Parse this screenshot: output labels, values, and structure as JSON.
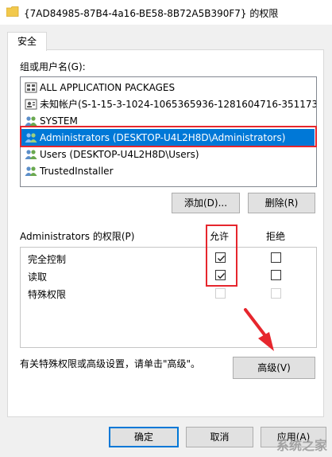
{
  "window": {
    "title": "{7AD84985-87B4-4a16-BE58-8B72A5B390F7} 的权限"
  },
  "tabs": [
    {
      "label": "安全"
    }
  ],
  "groups": {
    "label": "组或用户名(G):",
    "items": [
      {
        "label": "ALL APPLICATION PACKAGES",
        "icon": "app-packages-icon"
      },
      {
        "label": "未知帐户(S-1-15-3-1024-1065365936-1281604716-351173…",
        "icon": "unknown-account-icon"
      },
      {
        "label": "SYSTEM",
        "icon": "users-icon"
      },
      {
        "label": "Administrators (DESKTOP-U4L2H8D\\Administrators)",
        "icon": "users-icon",
        "selected": true
      },
      {
        "label": "Users (DESKTOP-U4L2H8D\\Users)",
        "icon": "users-icon"
      },
      {
        "label": "TrustedInstaller",
        "icon": "users-icon"
      }
    ]
  },
  "buttons": {
    "add": "添加(D)...",
    "remove": "删除(R)",
    "advanced": "高级(V)",
    "ok": "确定",
    "cancel": "取消",
    "apply": "应用(A)"
  },
  "permissions": {
    "header": "Administrators 的权限(P)",
    "allow_header": "允许",
    "deny_header": "拒绝",
    "rows": [
      {
        "name": "完全控制",
        "allow": true,
        "deny": false,
        "enabled": true
      },
      {
        "name": "读取",
        "allow": true,
        "deny": false,
        "enabled": true
      },
      {
        "name": "特殊权限",
        "allow": false,
        "deny": false,
        "enabled": false
      }
    ]
  },
  "advanced_hint": "有关特殊权限或高级设置，请单击\"高级\"。",
  "watermark": "系统之家",
  "colors": {
    "selection": "#0078d7",
    "highlight_box": "#e6262d"
  }
}
